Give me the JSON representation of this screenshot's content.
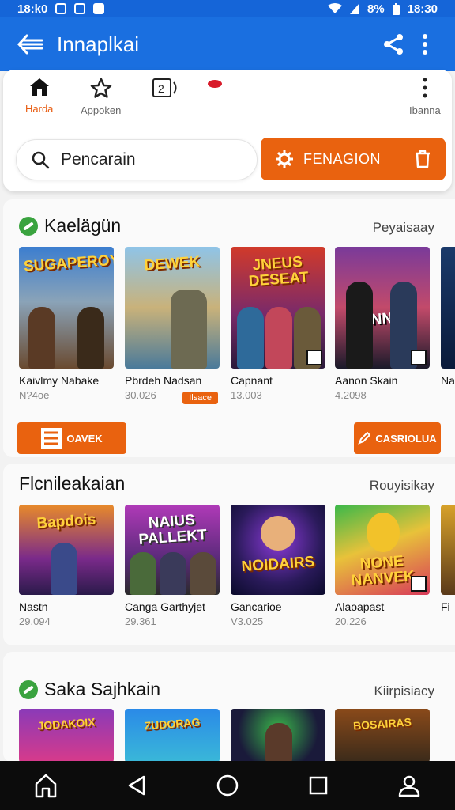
{
  "status_bar": {
    "time_left": "18:k0",
    "battery": "8%",
    "time_right": "18:30"
  },
  "app_bar": {
    "title": "Innaplkai"
  },
  "tabs": [
    {
      "label": "Harda",
      "icon": "home-icon",
      "active": true
    },
    {
      "label": "Appoken",
      "icon": "star-icon",
      "active": false
    },
    {
      "label": "",
      "icon": "library-icon",
      "active": false
    },
    {
      "label": "",
      "icon": "record-icon",
      "active": false
    },
    {
      "label": "Ibanna",
      "icon": "more-vertical-icon",
      "active": false
    }
  ],
  "search": {
    "placeholder": "Pencarain"
  },
  "primary_button": {
    "label": "FENAGION"
  },
  "accent_color": "#e9620f",
  "brand_color": "#1a6fe0",
  "sections": [
    {
      "title": "Kaelägün",
      "link": "Peyaisaay",
      "items": [
        {
          "title": "Kaivlmy Nabake",
          "sub": "N?4oe",
          "art": "SUGAPEROY",
          "badge": ""
        },
        {
          "title": "Pbrdeh Nadsan",
          "sub": "30.026",
          "art": "DEWEK",
          "badge": "Ilsace"
        },
        {
          "title": "Capnant",
          "sub": "13.003",
          "art": "JNEUS DESEAT",
          "badge": ""
        },
        {
          "title": "Aanon Skain",
          "sub": "4.2098",
          "art": "NUNNOR",
          "badge": ""
        },
        {
          "title": "Na",
          "sub": "",
          "art": "",
          "badge": ""
        }
      ],
      "buttons": {
        "left": "OAVEK",
        "right": "CASRIOLUA"
      }
    },
    {
      "title": "Flcnileakaian",
      "link": "Rouyisikay",
      "items": [
        {
          "title": "Nastn",
          "sub": "29.094",
          "art": "Bapdois",
          "badge": ""
        },
        {
          "title": "Canga Garthyjet",
          "sub": "29.361",
          "art": "NAIUS PALLEKT",
          "badge": ""
        },
        {
          "title": "Gancarioe",
          "sub": "V3.025",
          "art": "NOIDAIRS",
          "badge": ""
        },
        {
          "title": "Alaoapast",
          "sub": "20.226",
          "art": "NONE NANVEK",
          "badge": ""
        },
        {
          "title": "Fi",
          "sub": "",
          "art": "",
          "badge": ""
        }
      ]
    },
    {
      "title": "Saka Sajhkain",
      "link": "Kiirpisiacy",
      "items": [
        {
          "title": "",
          "sub": "",
          "art": "JODAKOIX",
          "badge": ""
        },
        {
          "title": "",
          "sub": "",
          "art": "ZUDORAG",
          "badge": ""
        },
        {
          "title": "",
          "sub": "",
          "art": "",
          "badge": ""
        },
        {
          "title": "",
          "sub": "",
          "art": "BOSAIRAS",
          "badge": ""
        }
      ]
    }
  ],
  "nav_bar": [
    "home-icon",
    "back-icon",
    "home-circle-icon",
    "recents-icon",
    "profile-icon"
  ]
}
